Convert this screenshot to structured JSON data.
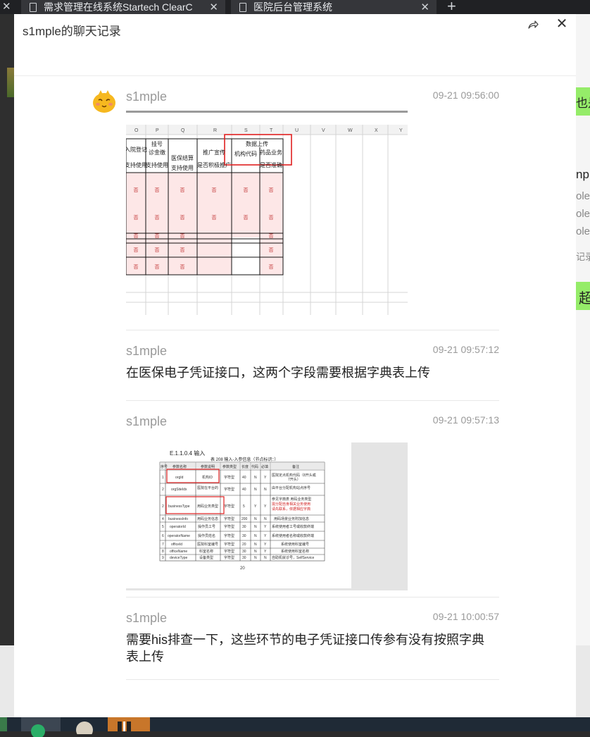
{
  "browser": {
    "tabs": [
      {
        "title": "需求管理在线系统Startech ClearC"
      },
      {
        "title": "医院后台管理系统"
      }
    ]
  },
  "background": {
    "right_texts": [
      "也是",
      "npl",
      "ole",
      "ole",
      "ole",
      "记录",
      "超"
    ]
  },
  "dialog": {
    "title": "s1mple的聊天记录",
    "messages": [
      {
        "sender": "s1mple",
        "time": "09-21 09:56:00",
        "type": "image"
      },
      {
        "sender": "s1mple",
        "time": "09-21 09:57:12",
        "type": "text",
        "text": "在医保电子凭证接口，这两个字段需要根据字典表上传"
      },
      {
        "sender": "s1mple",
        "time": "09-21 09:57:13",
        "type": "image"
      },
      {
        "sender": "s1mple",
        "time": "09-21 10:00:57",
        "type": "text",
        "text": "需要his排查一下，这些环节的电子凭证接口传参有没有按照字典表上传"
      }
    ]
  },
  "spreadsheet_image": {
    "columns": [
      "O",
      "P",
      "Q",
      "R",
      "S",
      "T",
      "U",
      "V",
      "W",
      "X",
      "Y"
    ],
    "headers": [
      "入院登记\n支持使用",
      "挂号\n诊金缴\n支付\n支持使用",
      "医保结算\n支持使用",
      "推广宣传\n是否积极推广",
      "机构代码",
      "药品业务\n是否准确"
    ],
    "group_header": "数据上传",
    "cell_value": "否"
  },
  "doc_image": {
    "section": "E.1.1.0.4  输入",
    "caption": "表 208 输入-入参信息（节点标识：）",
    "table_headers": [
      "序号",
      "参数名称",
      "参数说明",
      "参数类型",
      "长度",
      "代码标识",
      "是否必填",
      "备注"
    ],
    "rows": [
      [
        "1",
        "orgId",
        "机构ID",
        "字符型",
        "40",
        "N",
        "Y",
        "医院定点机构代码（8开头或7开头）"
      ],
      [
        "2",
        "orgSiteIdx",
        "医院在平台的序号",
        "字符型",
        "40",
        "N",
        "N",
        "由平台分配机构站点序号"
      ],
      [
        "3",
        "businessType",
        "用码业务类型",
        "字符型",
        "5",
        "Y",
        "Y",
        "参见字典表 用码业务类型"
      ],
      [
        "4",
        "businessInfo",
        "用码业务信息",
        "字符型",
        "200",
        "N",
        "N",
        "用码场景业务附加信息"
      ],
      [
        "5",
        "operatorId",
        "操作员工号",
        "字符型",
        "30",
        "N",
        "Y",
        "系统使用者工号或收款终端编号"
      ],
      [
        "6",
        "operatorName",
        "操作员姓名",
        "字符型",
        "30",
        "N",
        "Y",
        "系统使用者名称或收款终端名称"
      ],
      [
        "7",
        "officeId",
        "医院科室编号",
        "字符型",
        "20",
        "N",
        "Y",
        "系统使用科室编号"
      ],
      [
        "8",
        "officeName",
        "科室名称",
        "字符型",
        "30",
        "N",
        "Y",
        "系统使用科室名称"
      ],
      [
        "9",
        "deviceType",
        "设备类型",
        "字符型",
        "30",
        "N",
        "N",
        "自助机就诊号，SelfService"
      ]
    ],
    "page_number": "20"
  }
}
